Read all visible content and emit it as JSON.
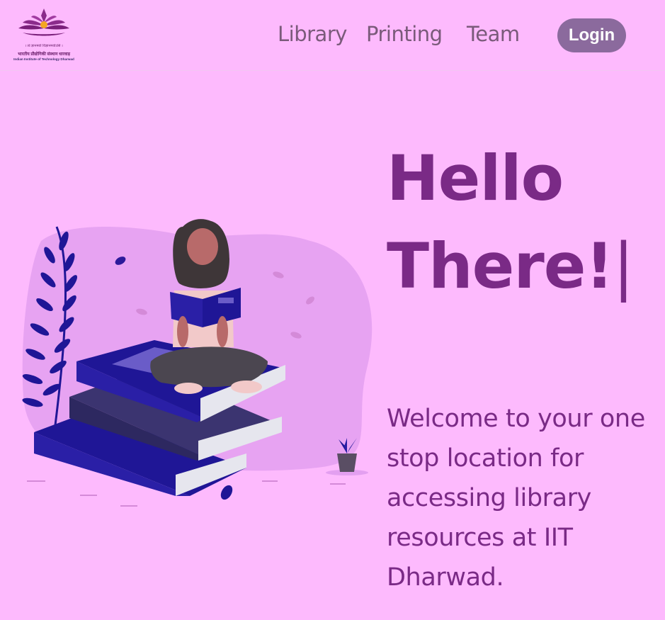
{
  "header": {
    "logo": {
      "motto": "। त्वं ज्ञानमयो विज्ञानमयोऽसि ।",
      "hindi_name": "भारतीय प्रौद्योगिकी संस्थान धारवाड़",
      "english_name": "Indian Institute of Technology Dharwad"
    },
    "nav": {
      "library": "Library",
      "printing": "Printing",
      "team": "Team"
    },
    "login_label": "Login"
  },
  "hero": {
    "heading_line1": "Hello",
    "heading_line2": "There!",
    "cursor": "|",
    "welcome_text": "Welcome to your one stop location for accessing library resources at IIT Dharwad."
  },
  "colors": {
    "background": "#fdbafd",
    "heading": "#7a2a86",
    "login_button": "#8b6a9d",
    "nav_text": "#7a5a7a",
    "book_blue": "#1f1696"
  }
}
